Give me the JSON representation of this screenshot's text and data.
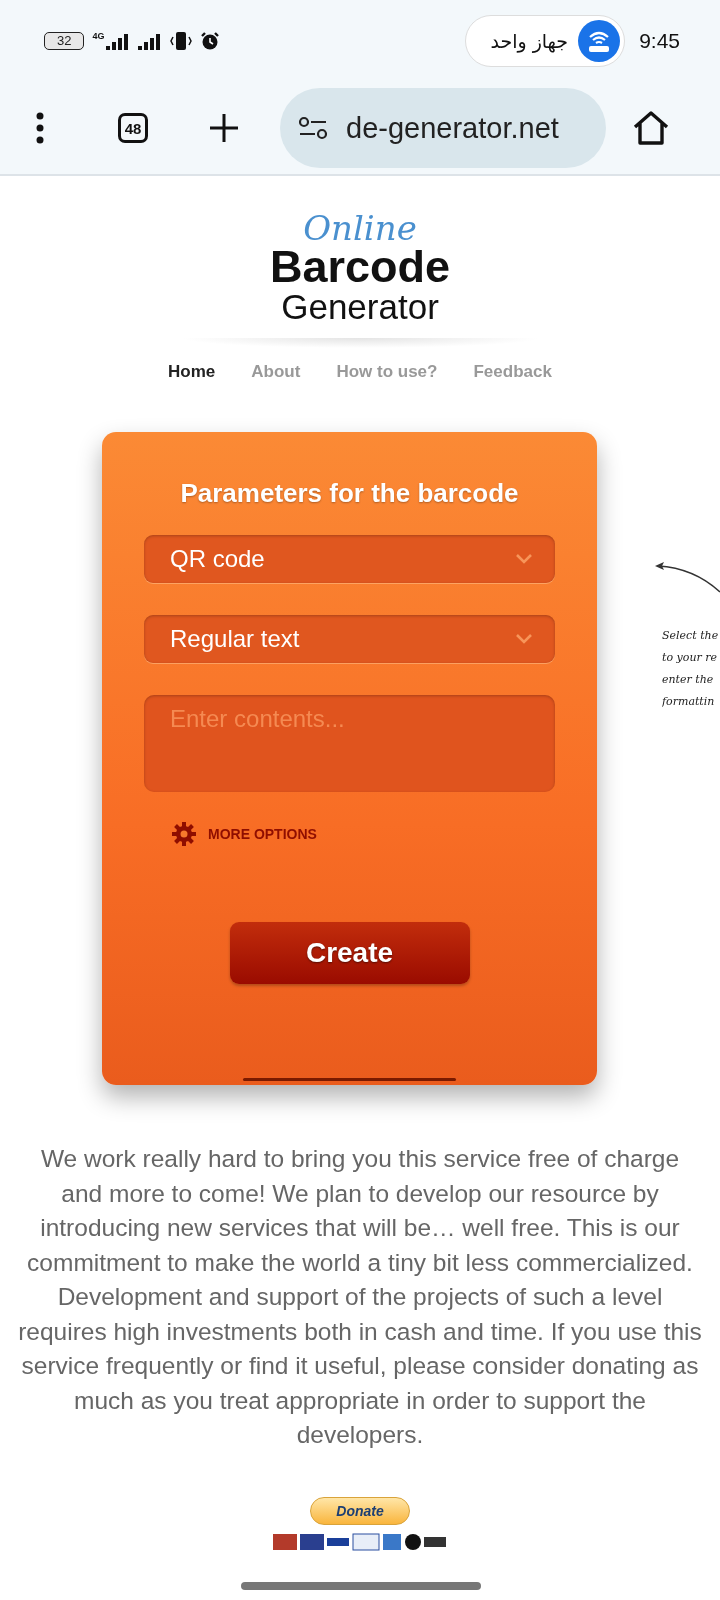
{
  "status_bar": {
    "battery": "32",
    "network": "4G",
    "chip_label": "جهاز واحد",
    "time": "9:45"
  },
  "browser": {
    "tab_count": "48",
    "url": "de-generator.net"
  },
  "logo": {
    "script": "Online",
    "title": "Barcode",
    "subtitle": "Generator"
  },
  "nav": [
    {
      "label": "Home",
      "selected": true
    },
    {
      "label": "About",
      "selected": false
    },
    {
      "label": "How to use?",
      "selected": false
    },
    {
      "label": "Feedback",
      "selected": false
    }
  ],
  "form": {
    "title": "Parameters for the barcode",
    "selects": [
      {
        "value": "QR code"
      },
      {
        "value": "Regular text"
      }
    ],
    "contents": {
      "placeholder": "Enter contents..."
    },
    "more_options": "MORE OPTIONS",
    "create_button": "Create"
  },
  "annotation": {
    "lines": [
      "Select the",
      "to your re",
      "enter the",
      "formattin"
    ]
  },
  "message": "We work really hard to bring you this service free of charge and more to come! We plan to develop our resource by introducing new services that will be… well free. This is our commitment to make the world a tiny bit less commercialized. Development and support of the projects of such a level requires high investments both in cash and time. If you use this service frequently or find it useful, please consider donating as much as you treat appropriate in order to support the developers.",
  "donate": {
    "button": "Donate"
  }
}
